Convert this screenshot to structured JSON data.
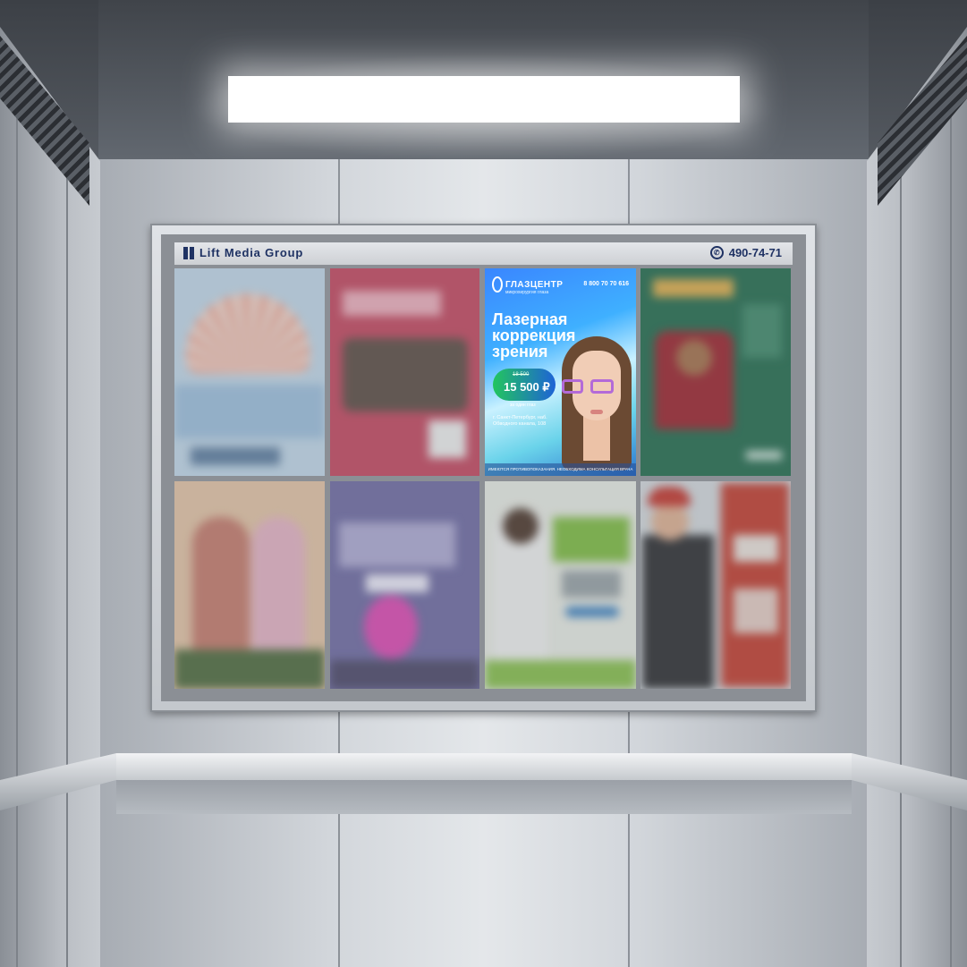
{
  "board": {
    "brand": "Lift Media Group",
    "phone": "490-74-71"
  },
  "featured_ad": {
    "clinic_name": "ГЛАЗЦЕНТР",
    "clinic_subtitle": "микрохирургия глаза",
    "phone": "8 800 70 70 616",
    "headline_1": "Лазерная",
    "headline_2": "коррекция",
    "headline_3": "зрения",
    "price_old": "18 500",
    "price_new": "15 500 ₽",
    "price_note": "за один глаз",
    "address": "г. Санкт-Петербург, наб. Обводного канала, 108",
    "footer": "ИМЕЮТСЯ ПРОТИВОПОКАЗАНИЯ. НЕОБХОДИМА КОНСУЛЬТАЦИЯ ВРАЧА"
  },
  "colors": {
    "brand_navy": "#1f3263",
    "featured_blue": "#3a86ff",
    "frame_metal": "#c4c8cd"
  },
  "icons": {
    "phone": "phone-icon",
    "brand": "brand-logo-icon"
  }
}
